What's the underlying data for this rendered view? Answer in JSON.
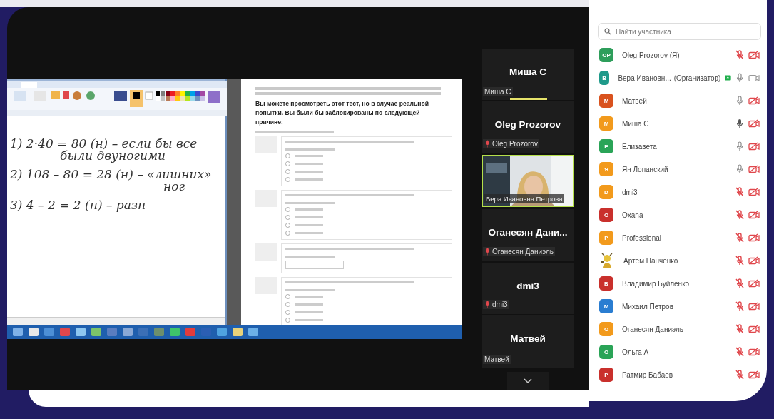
{
  "shared_screen": {
    "paint": {
      "handwriting": [
        {
          "kind": "step",
          "text": "1) 2·40 = 80 (н) – если бы все"
        },
        {
          "kind": "continuation",
          "text": "были двуногими"
        },
        {
          "kind": "step",
          "text": "2) 108 – 80 = 28 (н) – «лишних»"
        },
        {
          "kind": "tail",
          "text": "ног"
        },
        {
          "kind": "step",
          "text": "3) 4 – 2 = 2 (н) – разн"
        }
      ]
    },
    "browser": {
      "heading": "Вы можете просмотреть этот тест, но в случае реальной попытки. Вы были бы заблокированы по следующей причине:"
    }
  },
  "video_tiles": [
    {
      "kind": "avatar",
      "display_name": "Миша С",
      "label": "Миша С",
      "muted": false,
      "speaking": true
    },
    {
      "kind": "avatar",
      "display_name": "Oleg Prozorov",
      "label": "Oleg Prozorov",
      "muted": true,
      "speaking": false
    },
    {
      "kind": "video",
      "label": "Вера Ивановна Петрова",
      "selected": true
    },
    {
      "kind": "avatar",
      "display_name": "Оганесян Дани...",
      "label": "Оганесян Даниэль",
      "muted": true,
      "speaking": false
    },
    {
      "kind": "avatar",
      "display_name": "dmi3",
      "label": "dmi3",
      "muted": true,
      "speaking": false
    },
    {
      "kind": "avatar",
      "display_name": "Матвей",
      "label": "Матвей",
      "muted": false,
      "speaking": false
    }
  ],
  "participants_panel": {
    "search": {
      "placeholder": "Найти участника"
    },
    "participants": [
      {
        "kind": "initials",
        "initials": "OP",
        "color": "#2e9e5b",
        "name": "Oleg Prozorov (Я)",
        "mic_muted": true,
        "mic_active": false,
        "video_off": true
      },
      {
        "kind": "initials",
        "initials": "В",
        "color": "#1f9a8a",
        "name": "Вера Ивановн...",
        "role": "(Организатор)",
        "sharing": true,
        "mic_muted": false,
        "mic_active": false,
        "video_off": false
      },
      {
        "kind": "initials",
        "initials": "M",
        "color": "#d9521e",
        "name": "Матвей",
        "mic_muted": false,
        "mic_active": false,
        "video_off": true
      },
      {
        "kind": "initials",
        "initials": "M",
        "color": "#f29a1c",
        "name": "Миша С",
        "mic_muted": false,
        "mic_active": true,
        "video_off": true
      },
      {
        "kind": "initials",
        "initials": "E",
        "color": "#2aa457",
        "name": "Елизавета",
        "mic_muted": false,
        "mic_active": false,
        "video_off": true
      },
      {
        "kind": "initials",
        "initials": "Я",
        "color": "#f29a1c",
        "name": "Ян Лопанский",
        "mic_muted": false,
        "mic_active": false,
        "video_off": true
      },
      {
        "kind": "initials",
        "initials": "D",
        "color": "#f29a1c",
        "name": "dmi3",
        "mic_muted": true,
        "mic_active": false,
        "video_off": true
      },
      {
        "kind": "initials",
        "initials": "O",
        "color": "#c9302c",
        "name": "Oxana",
        "mic_muted": true,
        "mic_active": false,
        "video_off": true
      },
      {
        "kind": "initials",
        "initials": "P",
        "color": "#f29a1c",
        "name": "Professional",
        "mic_muted": true,
        "mic_active": false,
        "video_off": true
      },
      {
        "kind": "picture",
        "name": "Артём Панченко",
        "mic_muted": true,
        "mic_active": false,
        "video_off": true
      },
      {
        "kind": "initials",
        "initials": "В",
        "color": "#c9302c",
        "name": "Владимир Буйленко",
        "mic_muted": true,
        "mic_active": false,
        "video_off": true
      },
      {
        "kind": "initials",
        "initials": "M",
        "color": "#2a7dd1",
        "name": "Михаил Петров",
        "mic_muted": true,
        "mic_active": false,
        "video_off": true
      },
      {
        "kind": "initials",
        "initials": "O",
        "color": "#f29a1c",
        "name": "Оганесян Даниэль",
        "mic_muted": true,
        "mic_active": false,
        "video_off": true
      },
      {
        "kind": "initials",
        "initials": "O",
        "color": "#2aa457",
        "name": "Ольга А",
        "mic_muted": true,
        "mic_active": false,
        "video_off": true
      },
      {
        "kind": "initials",
        "initials": "P",
        "color": "#c9302c",
        "name": "Ратмир Бабаев",
        "mic_muted": true,
        "mic_active": false,
        "video_off": true
      }
    ]
  }
}
